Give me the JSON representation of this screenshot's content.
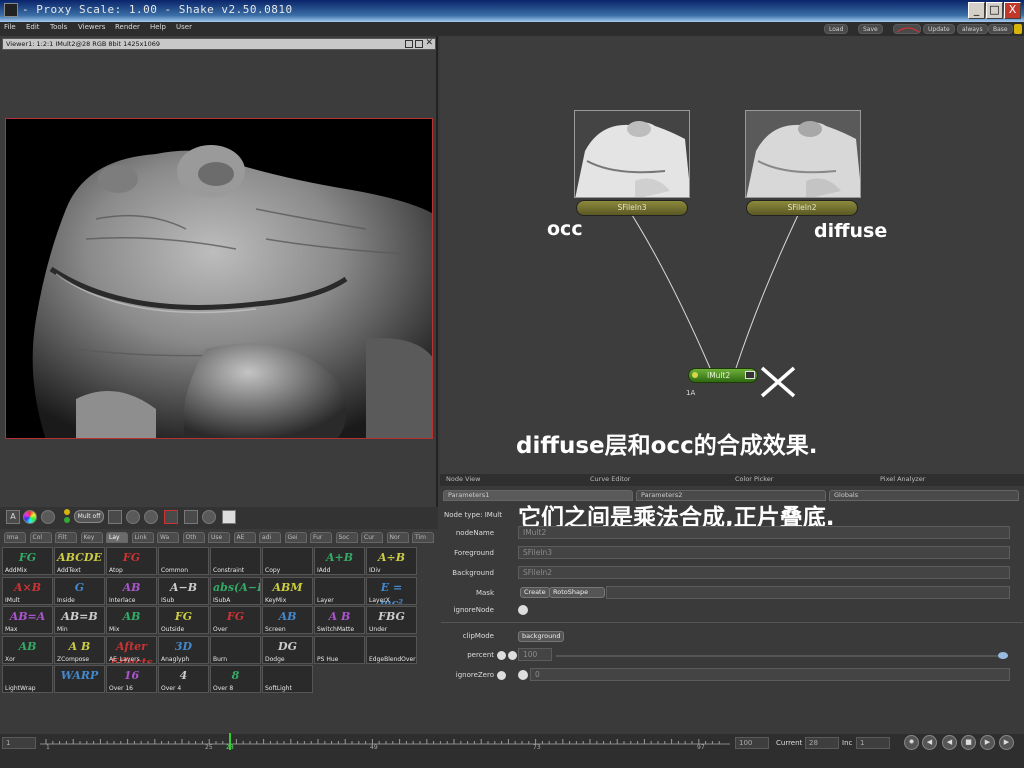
{
  "window": {
    "title": "- Proxy Scale: 1.00 - Shake v2.50.0810",
    "minimize": "_",
    "maximize": "□",
    "close": "X"
  },
  "menu": [
    "File",
    "Edit",
    "Tools",
    "Viewers",
    "Render",
    "Help",
    "User"
  ],
  "top_buttons": [
    "Load",
    "Save",
    "Update",
    "always",
    "Base"
  ],
  "viewer": {
    "header": "Viewer1: 1:2:1 IMult2@28 RGB 8bit 1425x1069",
    "toolbar": {
      "a_label": "A",
      "mult_label": "Mult off"
    }
  },
  "tool_tabs": [
    "Ima",
    "Col",
    "Filt",
    "Key",
    "Lay",
    "Link",
    "Wa",
    "Oth",
    "Use",
    "AE",
    "adi",
    "Gei",
    "Fur",
    "Soc",
    "Cur",
    "Nor",
    "Tim"
  ],
  "tools": [
    {
      "label": "AddMix",
      "icon": "FG"
    },
    {
      "label": "AddText",
      "icon": "ABCDE"
    },
    {
      "label": "Atop",
      "icon": "FG"
    },
    {
      "label": "Common",
      "icon": ""
    },
    {
      "label": "Constraint",
      "icon": ""
    },
    {
      "label": "Copy",
      "icon": ""
    },
    {
      "label": "IAdd",
      "icon": "A+B"
    },
    {
      "label": "IDiv",
      "icon": "A÷B"
    },
    {
      "label": "IMult",
      "icon": "A×B"
    },
    {
      "label": "Inside",
      "icon": "G"
    },
    {
      "label": "Interlace",
      "icon": "AB"
    },
    {
      "label": "ISub",
      "icon": "A−B"
    },
    {
      "label": "ISubA",
      "icon": "abs(A−B)"
    },
    {
      "label": "KeyMix",
      "icon": "ABM"
    },
    {
      "label": "Layer",
      "icon": ""
    },
    {
      "label": "LayerX",
      "icon": "E = mc²"
    },
    {
      "label": "Max",
      "icon": "AB=A"
    },
    {
      "label": "Min",
      "icon": "AB=B"
    },
    {
      "label": "Mix",
      "icon": "AB"
    },
    {
      "label": "Outside",
      "icon": "FG"
    },
    {
      "label": "Over",
      "icon": "FG"
    },
    {
      "label": "Screen",
      "icon": "AB"
    },
    {
      "label": "SwitchMatte",
      "icon": "A B"
    },
    {
      "label": "Under",
      "icon": "FBG"
    },
    {
      "label": "Xor",
      "icon": "AB"
    },
    {
      "label": "ZCompose",
      "icon": "A B"
    },
    {
      "label": "AE_Layers",
      "icon": "After Effects"
    },
    {
      "label": "Anaglyph",
      "icon": "3D"
    },
    {
      "label": "Burn",
      "icon": ""
    },
    {
      "label": "Dodge",
      "icon": "DG"
    },
    {
      "label": "PS Hue",
      "icon": ""
    },
    {
      "label": "EdgeBlendOver",
      "icon": ""
    },
    {
      "label": "LightWrap",
      "icon": ""
    },
    {
      "label": "",
      "icon": "WARP"
    },
    {
      "label": "Over 16",
      "icon": "16"
    },
    {
      "label": "Over 4",
      "icon": "4"
    },
    {
      "label": "Over 8",
      "icon": "8"
    },
    {
      "label": "SoftLight",
      "icon": ""
    }
  ],
  "nodes": {
    "occ_node": "SFileIn3",
    "diffuse_node": "SFileIn2",
    "mult_node": "IMult2",
    "mult_sub": "1A"
  },
  "annotations": {
    "occ": "occ",
    "diffuse": "diffuse",
    "caption1": "diffuse层和occ的合成效果.",
    "caption2": "它们之间是乘法合成,正片叠底."
  },
  "bottom_tabs": [
    "Node View",
    "Curve Editor",
    "Color Picker",
    "Pixel Analyzer"
  ],
  "param_tabs": [
    "Parameters1",
    "Parameters2",
    "Globals"
  ],
  "params": {
    "node_type": "Node type: IMult",
    "nodeName_label": "nodeName",
    "nodeName_value": "IMult2",
    "foreground_label": "Foreground",
    "foreground_value": "SFileIn3",
    "background_label": "Background",
    "background_value": "SFileIn2",
    "mask_label": "Mask",
    "create_btn": "Create",
    "rotoshape_btn": "RotoShape",
    "ignoreNode_label": "ignoreNode",
    "clipMode_label": "clipMode",
    "clipMode_value": "background",
    "percent_label": "percent",
    "percent_value": "100",
    "ignoreZero_label": "ignoreZero",
    "ignoreZero_value": "0"
  },
  "timeline": {
    "start": "1",
    "end": "100",
    "current_label": "Current",
    "current": "28",
    "inc_label": "Inc",
    "inc": "1",
    "ticks": [
      "1",
      "25",
      "28",
      "49",
      "73",
      "97"
    ]
  }
}
